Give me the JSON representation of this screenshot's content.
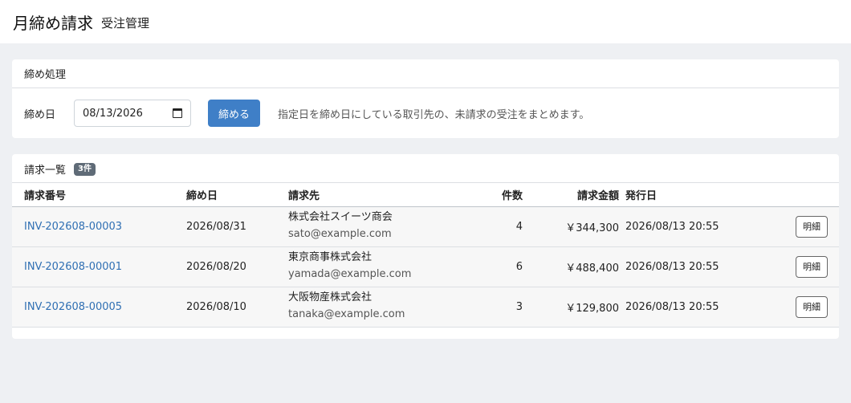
{
  "header": {
    "title": "月締め請求",
    "subtitle": "受注管理"
  },
  "closing": {
    "title": "締め処理",
    "date_label": "締め日",
    "date_value": "08/13/2026",
    "button_label": "締める",
    "description": "指定日を締め日にしている取引先の、未請求の受注をまとめます。"
  },
  "invoices": {
    "title": "請求一覧",
    "count_badge": "3件",
    "columns": [
      "請求番号",
      "締め日",
      "請求先",
      "件数",
      "請求金額",
      "発行日"
    ],
    "rows": [
      {
        "number": "INV-202608-00003",
        "closing_date": "2026/08/31",
        "client": "株式会社スイーツ商会",
        "email": "sato@example.com",
        "count": "4",
        "amount": "￥344,300",
        "issued": "2026/08/13 20:55",
        "action": "明細"
      },
      {
        "number": "INV-202608-00001",
        "closing_date": "2026/08/20",
        "client": "東京商事株式会社",
        "email": "yamada@example.com",
        "count": "6",
        "amount": "￥488,400",
        "issued": "2026/08/13 20:55",
        "action": "明細"
      },
      {
        "number": "INV-202608-00005",
        "closing_date": "2026/08/10",
        "client": "大阪物産株式会社",
        "email": "tanaka@example.com",
        "count": "3",
        "amount": "￥129,800",
        "issued": "2026/08/13 20:55",
        "action": "明細"
      }
    ]
  }
}
